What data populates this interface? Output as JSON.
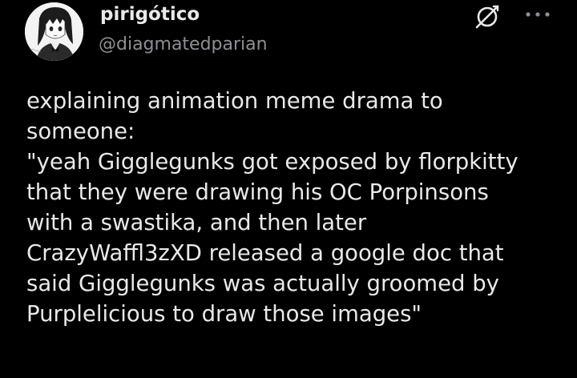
{
  "author": {
    "display_name": "pirigótico",
    "handle": "@diagmatedparian",
    "avatar_icon": "anime-girl-avatar"
  },
  "header_actions": {
    "grok_icon": "grok-icon",
    "more_icon": "more-horizontal-icon"
  },
  "tweet": {
    "lines": [
      "explaining animation meme drama to",
      "someone:",
      "\"yeah Gigglegunks got exposed by florpkitty",
      "that they were drawing his OC Porpinsons",
      "with a swastika, and then later",
      "CrazyWaffl3zXD released a google doc that",
      "said Gigglegunks was actually groomed by",
      "Purplelicious to draw those images\""
    ]
  },
  "colors": {
    "background": "#000000",
    "text_primary": "#e7e9ea",
    "text_secondary": "#8b9096"
  }
}
